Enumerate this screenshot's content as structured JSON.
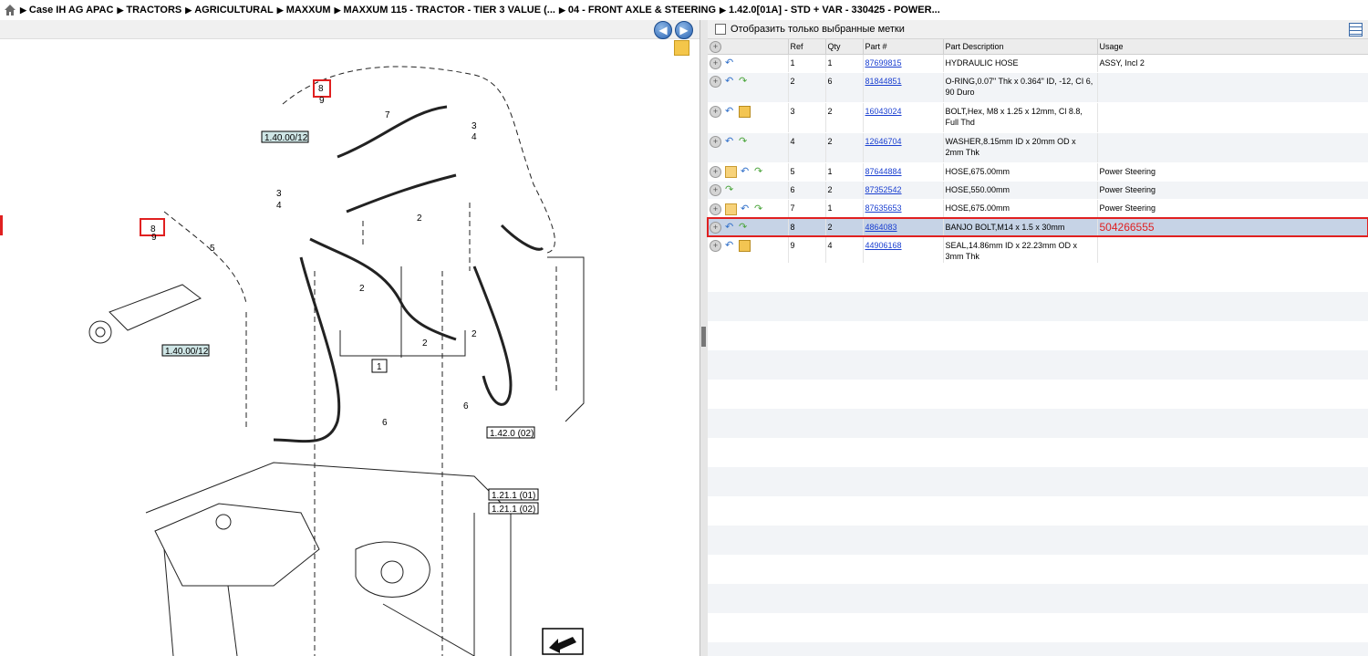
{
  "breadcrumb": [
    "Case IH AG APAC",
    "TRACTORS",
    "AGRICULTURAL",
    "MAXXUM",
    "MAXXUM 115 - TRACTOR - TIER 3 VALUE (...",
    "04 - FRONT AXLE & STEERING",
    "1.42.0[01A] - STD + VAR - 330425 - POWER..."
  ],
  "filter_label": "Отобразить только выбранные метки",
  "table": {
    "headers": [
      "Ref",
      "Qty",
      "Part #",
      "Part Description",
      "Usage"
    ],
    "rows": [
      {
        "ref": "1",
        "qty": "1",
        "part": "87699815",
        "desc": "HYDRAULIC HOSE",
        "usage": "ASSY, Incl 2"
      },
      {
        "ref": "2",
        "qty": "6",
        "part": "81844851",
        "desc": "O-RING,0.07\" Thk x 0.364\" ID, -12, CI 6, 90 Duro",
        "usage": ""
      },
      {
        "ref": "3",
        "qty": "2",
        "part": "16043024",
        "desc": "BOLT,Hex, M8 x 1.25 x 12mm, Cl 8.8, Full Thd",
        "usage": ""
      },
      {
        "ref": "4",
        "qty": "2",
        "part": "12646704",
        "desc": "WASHER,8.15mm ID x 20mm OD x 2mm Thk",
        "usage": ""
      },
      {
        "ref": "5",
        "qty": "1",
        "part": "87644884",
        "desc": "HOSE,675.00mm",
        "usage": "Power Steering"
      },
      {
        "ref": "6",
        "qty": "2",
        "part": "87352542",
        "desc": "HOSE,550.00mm",
        "usage": "Power Steering"
      },
      {
        "ref": "7",
        "qty": "1",
        "part": "87635653",
        "desc": "HOSE,675.00mm",
        "usage": "Power Steering"
      },
      {
        "ref": "8",
        "qty": "2",
        "part": "4864083",
        "desc": "BANJO BOLT,M14 x 1.5 x 30mm",
        "usage": "504266555"
      },
      {
        "ref": "9",
        "qty": "4",
        "part": "44906168",
        "desc": "SEAL,14.86mm ID x 22.23mm OD x 3mm Thk",
        "usage": ""
      }
    ]
  },
  "diagram": {
    "callouts": [
      "1",
      "2",
      "2",
      "2",
      "2",
      "3",
      "3",
      "4",
      "4",
      "5",
      "6",
      "6",
      "7",
      "8",
      "8",
      "9",
      "9"
    ],
    "refs": [
      "1.40.00/12",
      "1.40.00/12",
      "1.42.0 (02)",
      "1.21.1 (01)",
      "1.21.1 (02)"
    ]
  }
}
